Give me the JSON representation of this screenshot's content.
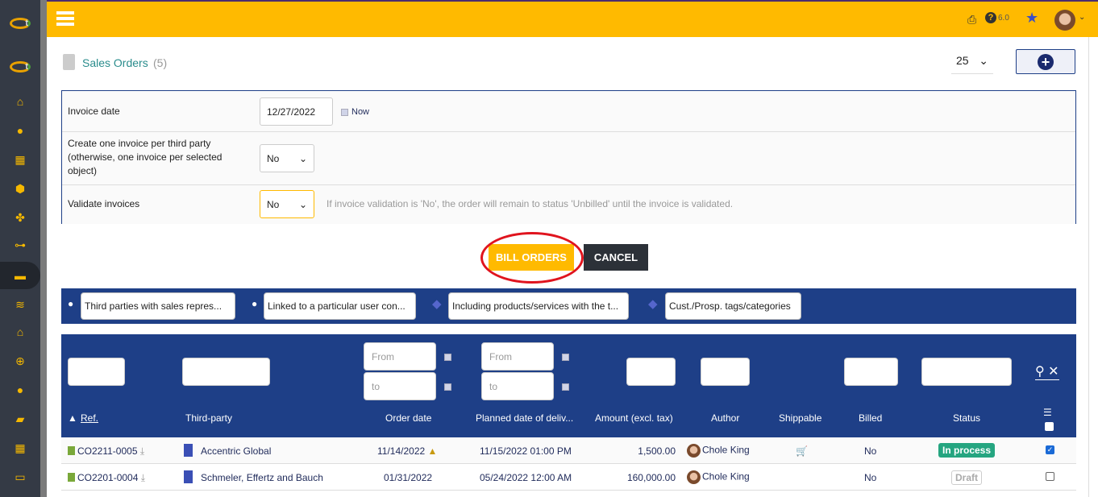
{
  "header": {
    "version": "6.0",
    "icons": [
      "print-icon",
      "help-icon",
      "star-icon",
      "user-avatar",
      "chevron-down-icon"
    ]
  },
  "sidebar": {
    "items": [
      "home",
      "user",
      "building",
      "box",
      "cubes",
      "sitemap",
      "briefcase",
      "coins",
      "bank",
      "search-dollar",
      "user-tie",
      "folder-open",
      "calendar",
      "ticket"
    ],
    "active": "briefcase"
  },
  "page": {
    "title": "Sales Orders",
    "count": "(5)",
    "page_size": "25"
  },
  "form": {
    "invoice_date_label": "Invoice date",
    "invoice_date_value": "12/27/2022",
    "now_label": "Now",
    "one_invoice_label": "Create one invoice per third party (otherwise, one invoice per selected object)",
    "one_invoice_value": "No",
    "validate_label": "Validate invoices",
    "validate_value": "No",
    "validate_help": "If invoice validation is 'No', the order will remain to status 'Unbilled' until the invoice is validated."
  },
  "actions": {
    "bill": "BILL ORDERS",
    "cancel": "CANCEL"
  },
  "filters": [
    "Third parties with sales repres...",
    "Linked to a particular user con...",
    "Including products/services with the t...",
    "Cust./Prosp. tags/categories"
  ],
  "search": {
    "from": "From",
    "to": "to"
  },
  "table": {
    "columns": [
      "Ref.",
      "Third-party",
      "Order date",
      "Planned date of deliv...",
      "Amount (excl. tax)",
      "Author",
      "Shippable",
      "Billed",
      "Status"
    ],
    "rows": [
      {
        "ref": "CO2211-0005",
        "thirdparty": "Accentric Global",
        "order_date": "11/14/2022",
        "delivery": "11/15/2022 01:00 PM",
        "amount": "1,500.00",
        "author": "Chole King",
        "shippable": true,
        "billed": "No",
        "status": "In process",
        "checked": true,
        "warning": true
      },
      {
        "ref": "CO2201-0004",
        "thirdparty": "Schmeler, Effertz and Bauch",
        "order_date": "01/31/2022",
        "delivery": "05/24/2022 12:00 AM",
        "amount": "160,000.00",
        "author": "Chole King",
        "shippable": false,
        "billed": "No",
        "status": "Draft",
        "checked": false,
        "warning": false
      }
    ]
  },
  "colors": {
    "topbar": "#ffba00",
    "sidebar": "#343a45",
    "navy": "#1e3f87",
    "in_process": "#25a580",
    "title": "#2a8c8c",
    "highlight_circle": "#e0141e"
  }
}
